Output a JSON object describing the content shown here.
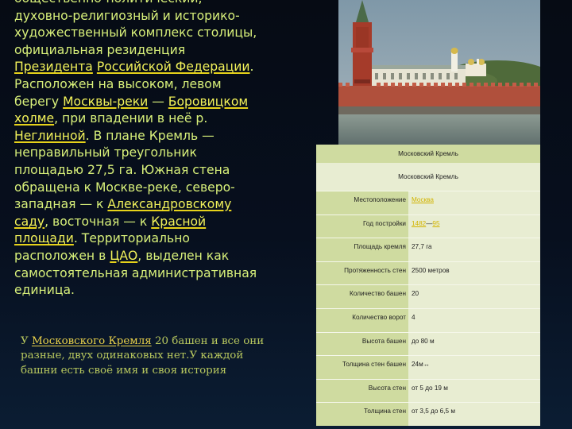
{
  "left_text": {
    "t1": "общественно-политический, духовно-религиозный и историко-художественный комплекс столицы, официальная резиденция ",
    "l1": "Президента",
    "t2": " ",
    "l2": "Российской Федерации",
    "t3": ". Расположен на высоком, левом берегу ",
    "l3": "Москвы-реки",
    "t4": " — ",
    "l4": "Боровицком холме",
    "t5": ", при впадении в неё р. ",
    "l5": "Неглинной",
    "t6": ". В плане Кремль — неправильный треугольник площадью 27,5 га. Южная стена обращена к Москве-реке, северо-западная — к ",
    "l6": "Александровскому саду",
    "t7": ", восточная — к ",
    "l7": "Красной площади",
    "t8": ". Территориально расположен в ",
    "l8": "ЦАО",
    "t9": ", выделен как самостоятельная административная единица."
  },
  "infobox": {
    "title": "Московский Кремль",
    "subtitle": "Московский Кремль",
    "rows": [
      {
        "key": "Местоположение",
        "value": "Москва",
        "link": true
      },
      {
        "key": "Год постройки",
        "value_a": "1482",
        "value_sep": "—",
        "value_b": "95"
      },
      {
        "key": "Площадь кремля",
        "value": "27,7 га"
      },
      {
        "key": "Протяженность стен",
        "value": "2500 метров"
      },
      {
        "key": "Количество башен",
        "value": "20"
      },
      {
        "key": "Количество ворот",
        "value": "4"
      },
      {
        "key": "Высота башен",
        "value": "до 80 м"
      },
      {
        "key": "Толщина стен башен",
        "value": "24м↔"
      },
      {
        "key": "Высота стен",
        "value": "от 5 до 19 м"
      },
      {
        "key": "Толщина стен",
        "value": "от 3,5 до 6,5 м"
      }
    ]
  },
  "bottom_text": {
    "pre": "У ",
    "link": "Московского Кремля",
    "post": " 20 башен и все они разные, двух одинаковых нет.У каждой башни есть своё имя и своя история"
  },
  "colors": {
    "background": "#070f1e",
    "text_main": "#d8f07a",
    "link": "#f2f25a",
    "infobox_key_bg": "#cfdba0",
    "infobox_value_bg": "#e8edd2"
  }
}
